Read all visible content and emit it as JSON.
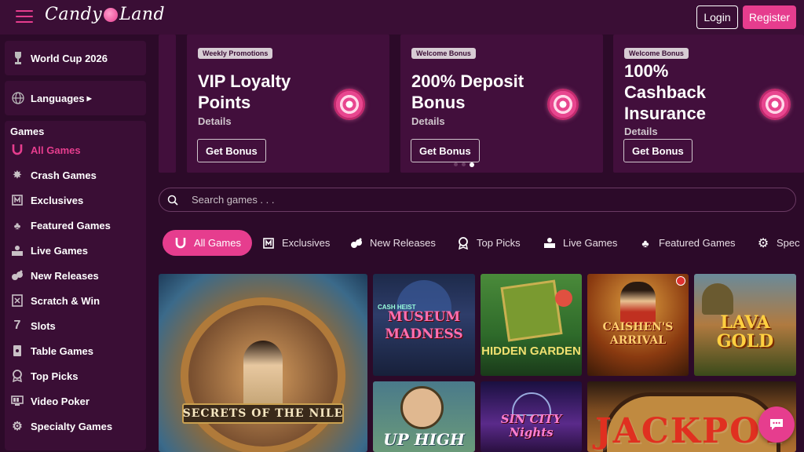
{
  "header": {
    "logo_text_1": "Candy",
    "logo_text_2": "Land",
    "login_label": "Login",
    "register_label": "Register"
  },
  "sidebar": {
    "world_cup": "World Cup 2026",
    "languages": "Languages",
    "games_title": "Games",
    "items": [
      {
        "label": "All Games",
        "icon": "horseshoe-icon"
      },
      {
        "label": "Crash Games",
        "icon": "explosion-icon"
      },
      {
        "label": "Exclusives",
        "icon": "exclusive-icon"
      },
      {
        "label": "Featured Games",
        "icon": "clover-icon"
      },
      {
        "label": "Live Games",
        "icon": "live-dealer-icon"
      },
      {
        "label": "New Releases",
        "icon": "new-releases-icon"
      },
      {
        "label": "Scratch & Win",
        "icon": "scratch-card-icon"
      },
      {
        "label": "Slots",
        "icon": "slot-seven-icon"
      },
      {
        "label": "Table Games",
        "icon": "table-games-icon"
      },
      {
        "label": "Top Picks",
        "icon": "medal-icon"
      },
      {
        "label": "Video Poker",
        "icon": "video-poker-icon"
      },
      {
        "label": "Specialty Games",
        "icon": "gear-icon"
      }
    ]
  },
  "promos": [
    {
      "tag": "Weekly Promotions",
      "title": "VIP Loyalty Points",
      "details": "Details",
      "button": "Get Bonus"
    },
    {
      "tag": "Welcome Bonus",
      "title": "200% Deposit Bonus",
      "details": "Details",
      "button": "Get Bonus"
    },
    {
      "tag": "Welcome Bonus",
      "title": "100% Cashback Insurance",
      "details": "Details",
      "button": "Get Bonus"
    }
  ],
  "search": {
    "placeholder": "Search games . . ."
  },
  "tabs": [
    {
      "label": "All Games"
    },
    {
      "label": "Exclusives"
    },
    {
      "label": "New Releases"
    },
    {
      "label": "Top Picks"
    },
    {
      "label": "Live Games"
    },
    {
      "label": "Featured Games"
    },
    {
      "label": "Spec"
    }
  ],
  "games": [
    {
      "title": "SECRETS OF THE NILE"
    },
    {
      "title_top": "CASH HEIST",
      "title": "MUSEUM MADNESS"
    },
    {
      "title": "HIDDEN GARDEN"
    },
    {
      "title": "CAISHEN'S ARRIVAL"
    },
    {
      "title": "LAVA GOLD"
    },
    {
      "title": "UP HIGH"
    },
    {
      "title": "SIN CITY Nights"
    },
    {
      "title": "JACKPOT"
    }
  ],
  "colors": {
    "accent": "#e63d8e",
    "background": "#2c0a29",
    "panel": "#3a0e35"
  }
}
